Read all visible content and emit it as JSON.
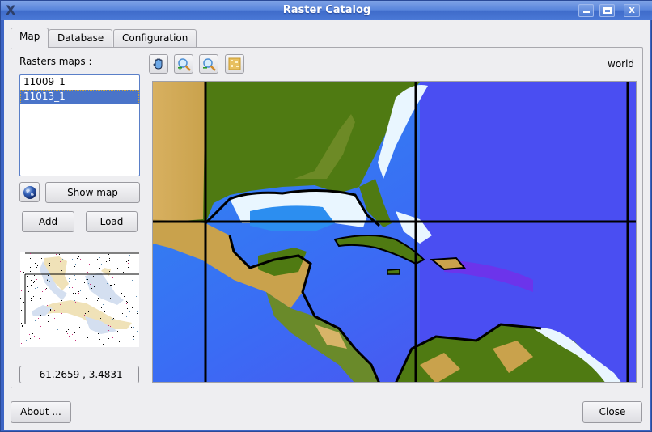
{
  "window": {
    "title": "Raster Catalog",
    "controls": [
      "minimize",
      "maximize",
      "close"
    ]
  },
  "tabs": [
    {
      "label": "Map",
      "active": true
    },
    {
      "label": "Database",
      "active": false
    },
    {
      "label": "Configuration",
      "active": false
    }
  ],
  "sidebar": {
    "rasters_label": "Rasters maps :",
    "rasters": [
      {
        "label": "11009_1",
        "selected": false
      },
      {
        "label": "11013_1",
        "selected": true
      }
    ],
    "globe_icon": "globe-icon",
    "show_map_label": "Show map",
    "add_label": "Add",
    "load_label": "Load",
    "coordinates": "-61.2659 , 3.4831"
  },
  "toolbar": {
    "tools": [
      {
        "name": "pan",
        "icon": "hand-icon"
      },
      {
        "name": "zoom-in",
        "icon": "zoom-in-icon"
      },
      {
        "name": "zoom-out",
        "icon": "zoom-out-icon"
      },
      {
        "name": "full-extent",
        "icon": "raster-extent-icon"
      }
    ],
    "layer_label": "world"
  },
  "map": {
    "region": "Gulf of Mexico and Caribbean",
    "colors": {
      "ocean_deep": "#4a50f2",
      "ocean_mid": "#1e8af0",
      "ocean_shallow": "#e8f6ff",
      "land_low": "#4f7a12",
      "land_high": "#d8b468",
      "grid": "#000000"
    }
  },
  "footer": {
    "about_label": "About ...",
    "close_label": "Close"
  }
}
